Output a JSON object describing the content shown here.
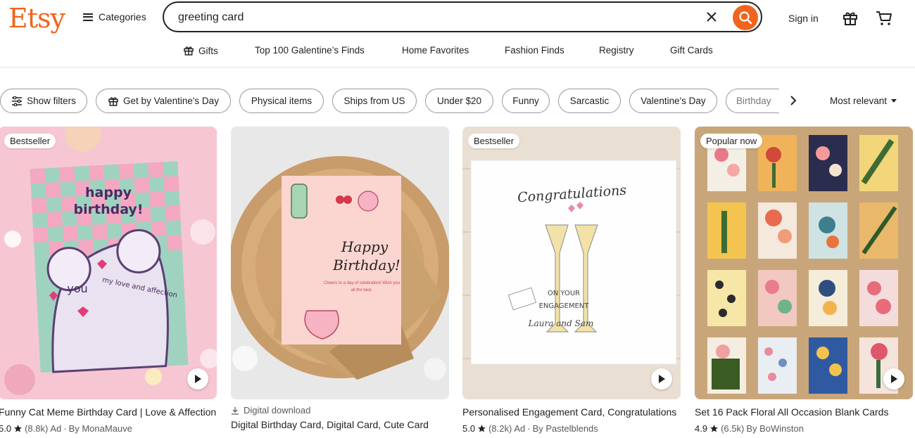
{
  "header": {
    "logo": "Etsy",
    "categories_label": "Categories",
    "search_value": "greeting card",
    "signin_label": "Sign in"
  },
  "nav": [
    "Gifts",
    "Top 100 Galentine’s Finds",
    "Home Favorites",
    "Fashion Finds",
    "Registry",
    "Gift Cards"
  ],
  "filters": {
    "show_filters": "Show filters",
    "chips": [
      "Get by Valentine's Day",
      "Physical items",
      "Ships from US",
      "Under $20",
      "Funny",
      "Sarcastic",
      "Valentine's Day",
      "Birthday"
    ],
    "sort_label": "Most relevant"
  },
  "listings": [
    {
      "badge": "Bestseller",
      "title": "Funny Cat Meme Birthday Card | Love & Affection",
      "rating": "5.0",
      "reviews": "(8.8k)",
      "ad": "Ad",
      "by": "By MonaMauve",
      "card_text_1": "happy",
      "card_text_2": "birthday!",
      "card_text_3": "you",
      "card_text_4": "my love and affection"
    },
    {
      "download": "Digital download",
      "title": "Digital Birthday Card, Digital Card, Cute Card",
      "card_text_1": "Happy",
      "card_text_2": "Birthday!",
      "card_text_3": "Cheers to a day of celebration! Wish you all the best."
    },
    {
      "badge": "Bestseller",
      "title": "Personalised Engagement Card, Congratulations",
      "rating": "5.0",
      "reviews": "(8.2k)",
      "ad": "Ad",
      "by": "By Pastelblends",
      "card_text_1": "Congratulations",
      "card_text_2": "ON YOUR",
      "card_text_3": "ENGAGEMENT",
      "card_text_4": "Laura and Sam"
    },
    {
      "badge": "Popular now",
      "title": "Set 16 Pack Floral All Occasion Blank Cards",
      "rating": "4.9",
      "reviews": "(6.5k)",
      "by": "By BoWinston"
    }
  ],
  "colors": {
    "brand": "#f1641e",
    "text": "#222222",
    "muted": "#595959"
  }
}
